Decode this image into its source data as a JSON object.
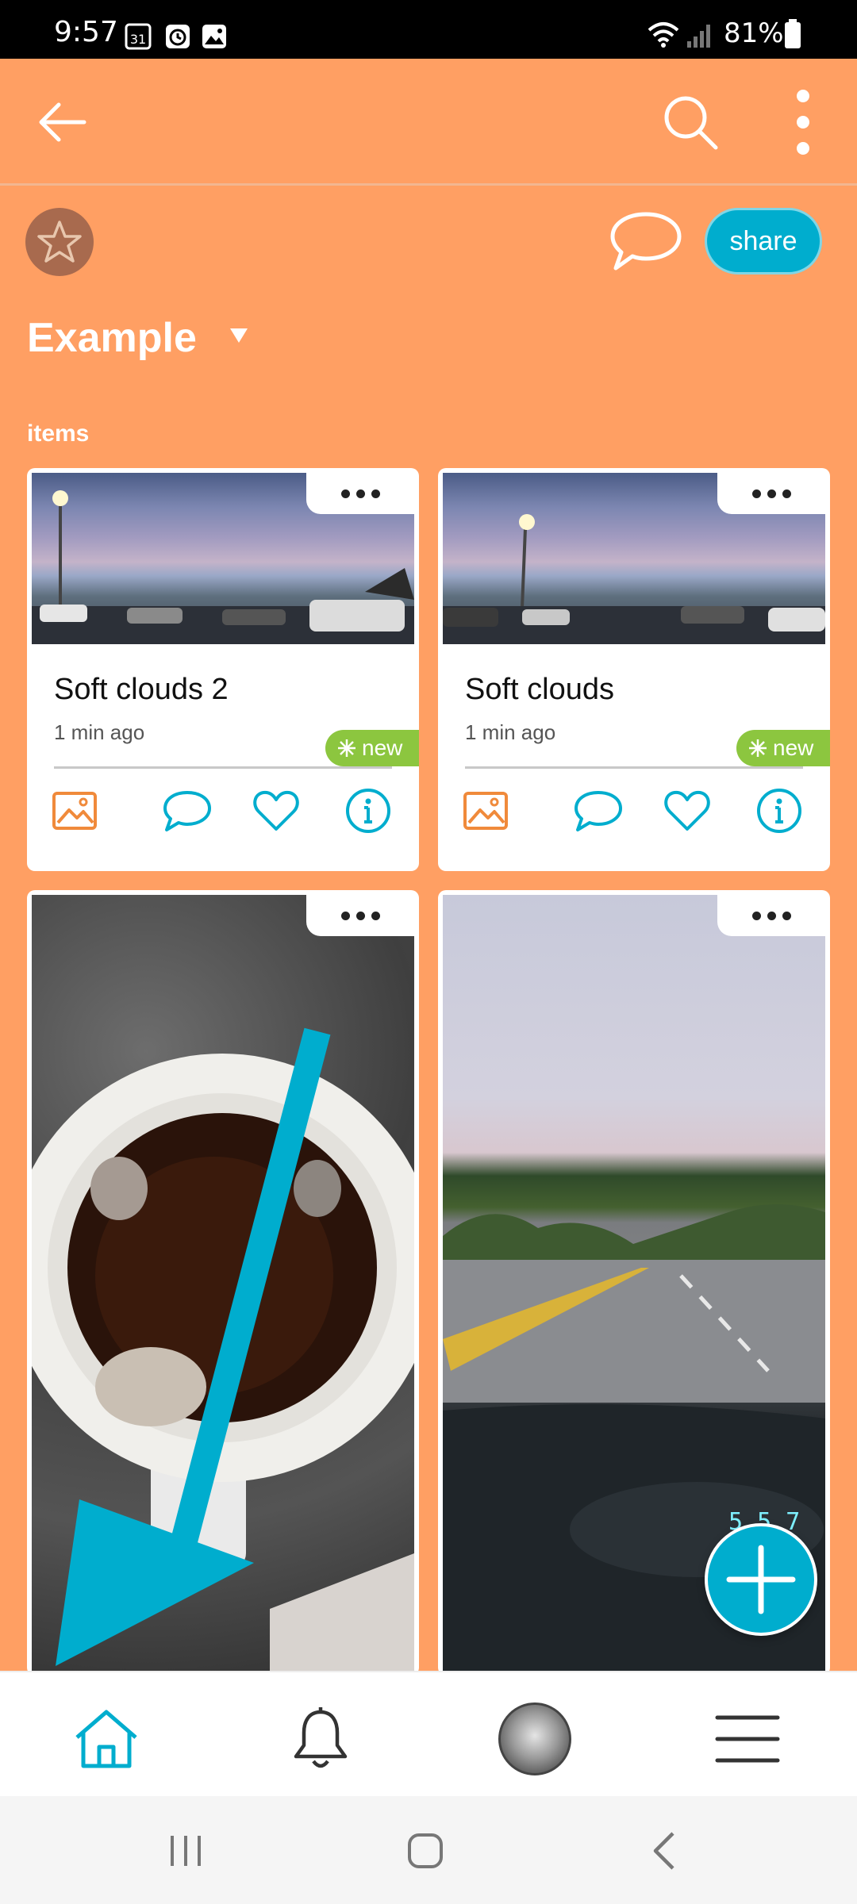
{
  "status_bar": {
    "time": "9:57",
    "battery": "81%",
    "icons": [
      "calendar-icon",
      "alarm-icon",
      "gallery-icon",
      "wifi-icon",
      "signal-icon",
      "battery-icon"
    ]
  },
  "app_bar": {
    "icons": [
      "back-arrow-icon",
      "search-icon",
      "more-vert-icon"
    ]
  },
  "header": {
    "share_label": "share",
    "title": "Example",
    "section_label": "items"
  },
  "cards": [
    {
      "title": "Soft clouds 2",
      "time": "1 min ago",
      "badge": "new"
    },
    {
      "title": "Soft clouds",
      "time": "1 min ago",
      "badge": "new"
    },
    {
      "title": "",
      "time": ""
    },
    {
      "title": "",
      "time": ""
    }
  ],
  "card_actions": [
    "image-icon",
    "comment-icon",
    "heart-icon",
    "info-icon"
  ],
  "bottom_nav": [
    "home-icon",
    "bell-icon",
    "avatar",
    "menu-icon"
  ],
  "colors": {
    "background": "#FF9F63",
    "accent": "#00ADCE",
    "badge": "#8CC63F",
    "image_icon": "#F08A3B"
  }
}
